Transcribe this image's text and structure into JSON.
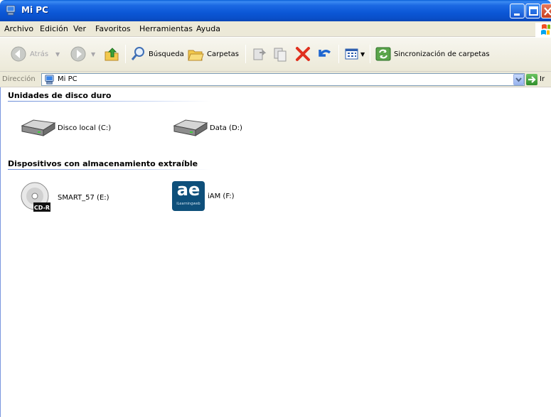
{
  "window": {
    "title": "Mi PC"
  },
  "menu": [
    "Archivo",
    "Edición",
    "Ver",
    "Favoritos",
    "Herramientas",
    "Ayuda"
  ],
  "toolbar": {
    "back": "Atrás",
    "search": "Búsqueda",
    "folders": "Carpetas",
    "sync": "Sincronización de carpetas"
  },
  "address": {
    "label": "Dirección",
    "value": "Mi PC",
    "go": "Ir"
  },
  "groups": {
    "hard_disks": {
      "title": "Unidades de disco duro",
      "items": [
        "Disco local (C:)",
        "Data (D:)"
      ]
    },
    "removable": {
      "title": "Dispositivos con almacenamiento extraíble",
      "items": [
        "SMART_57 (E:)",
        "iAM (F:)"
      ],
      "cd_badge": "CD-R",
      "iam_logo_text": "ae",
      "iam_logo_sub": "iLearningweb"
    }
  },
  "colors": {
    "title_bar": "#0a5fd8",
    "chrome": "#ece9d8",
    "iam_tile": "#0e4f7a"
  }
}
